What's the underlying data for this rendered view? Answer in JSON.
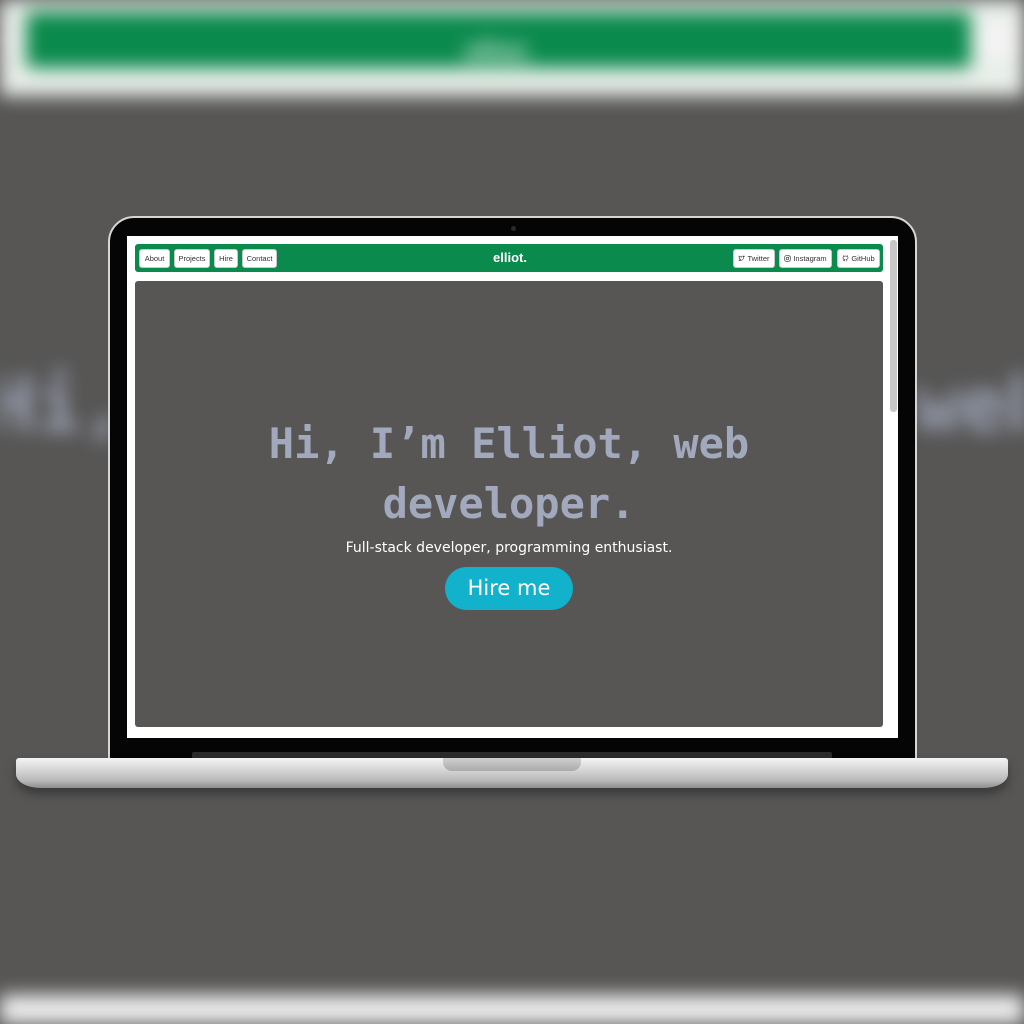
{
  "background": {
    "brand": "elliot.",
    "hero_left_fragment": "Hi,",
    "hero_right_fragment": "web"
  },
  "navbar": {
    "brand": "elliot.",
    "left_links": [
      "About",
      "Projects",
      "Hire",
      "Contact"
    ],
    "right_links": [
      {
        "label": "Twitter",
        "icon": "twitter-icon"
      },
      {
        "label": "Instagram",
        "icon": "instagram-icon"
      },
      {
        "label": "GitHub",
        "icon": "github-icon"
      }
    ]
  },
  "hero": {
    "title_line1": "Hi, I’m Elliot, web",
    "title_line2": "developer.",
    "subtitle": "Full-stack developer, programming enthusiast.",
    "cta": "Hire me"
  },
  "colors": {
    "nav_green": "#0b8a4d",
    "hero_bg": "#575655",
    "title_color": "#a3a9bd",
    "cta_color": "#12b2cc"
  }
}
